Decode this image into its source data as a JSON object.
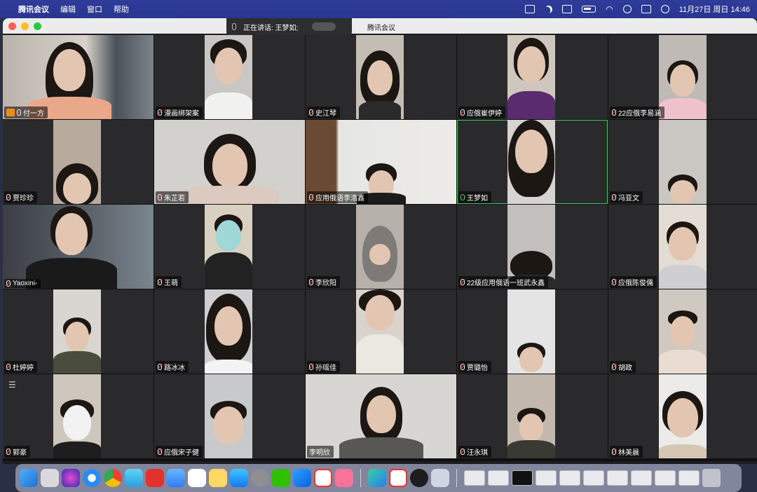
{
  "menubar": {
    "app_name": "腾讯会议",
    "menus": [
      "编辑",
      "窗口",
      "帮助"
    ],
    "datetime": "11月27日 周日  14:46"
  },
  "window": {
    "title": "腾讯会议",
    "speaking_label": "正在讲话: 王梦如;"
  },
  "participants": [
    {
      "name": "付一方",
      "host": true,
      "mic": "muted"
    },
    {
      "name": "漫画绑架案",
      "mic": "muted"
    },
    {
      "name": "史江琴",
      "mic": "muted"
    },
    {
      "name": "应俄崔伊婷",
      "mic": "muted"
    },
    {
      "name": "22应俄李易涵",
      "mic": "muted"
    },
    {
      "name": "贾珍珍",
      "mic": "muted"
    },
    {
      "name": "朱芷若",
      "mic": "muted"
    },
    {
      "name": "应用俄语李浩鑫",
      "mic": "muted"
    },
    {
      "name": "王梦如",
      "mic": "on",
      "active": true
    },
    {
      "name": "冯亚文",
      "mic": "muted"
    },
    {
      "name": "Yaoxini-",
      "mic": "muted"
    },
    {
      "name": "王萌",
      "mic": "muted"
    },
    {
      "name": "李欣阳",
      "mic": "muted"
    },
    {
      "name": "22级应用俄语一班武永鑫",
      "mic": "muted"
    },
    {
      "name": "应俄陈俊儒",
      "mic": "muted"
    },
    {
      "name": "杜婷婷",
      "mic": "muted"
    },
    {
      "name": "路冰冰",
      "mic": "muted"
    },
    {
      "name": "孙瑶佳",
      "mic": "muted"
    },
    {
      "name": "贾璐怡",
      "mic": "muted"
    },
    {
      "name": "胡政",
      "mic": "muted"
    },
    {
      "name": "郭豪",
      "mic": "muted"
    },
    {
      "name": "应俄宋子健",
      "mic": "muted"
    },
    {
      "name": "李明欣",
      "mic": "none"
    },
    {
      "name": "汪永琪",
      "mic": "muted"
    },
    {
      "name": "林美晨",
      "mic": "muted"
    }
  ],
  "dock": {
    "icons": [
      "finder-icon",
      "launchpad-icon",
      "siri-icon",
      "safari-icon",
      "chrome-icon",
      "files-icon",
      "weibo-icon",
      "mail-icon",
      "reminders-icon",
      "notes-icon",
      "appstore-icon",
      "settings-icon",
      "wechat-icon",
      "tencent-meeting-icon",
      "wps-icon",
      "bilibili-icon",
      "infuse-icon",
      "wps-office-icon",
      "quicktime-icon",
      "preview-icon"
    ]
  }
}
